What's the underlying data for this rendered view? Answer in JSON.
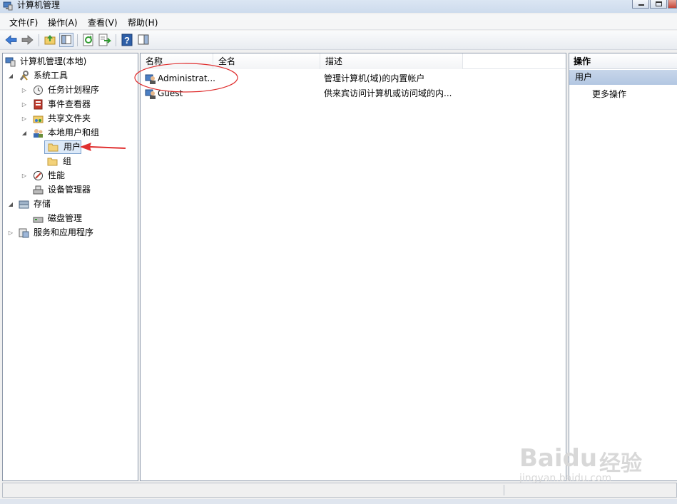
{
  "window": {
    "title": "计算机管理"
  },
  "menu": [
    "文件(F)",
    "操作(A)",
    "查看(V)",
    "帮助(H)"
  ],
  "tree": {
    "root": "计算机管理(本地)",
    "system_tools": "系统工具",
    "task_scheduler": "任务计划程序",
    "event_viewer": "事件查看器",
    "shared_folders": "共享文件夹",
    "local_users_groups": "本地用户和组",
    "users": "用户",
    "groups": "组",
    "performance": "性能",
    "device_manager": "设备管理器",
    "storage": "存储",
    "disk_management": "磁盘管理",
    "services_apps": "服务和应用程序"
  },
  "list": {
    "columns": [
      "名称",
      "全名",
      "描述"
    ],
    "rows": [
      {
        "name": "Administrat...",
        "fullname": "",
        "description": "管理计算机(域)的内置帐户"
      },
      {
        "name": "Guest",
        "fullname": "",
        "description": "供来宾访问计算机或访问域的内..."
      }
    ]
  },
  "actions": {
    "header": "操作",
    "section": "用户",
    "more": "更多操作"
  },
  "watermark": {
    "brand": "Baidu",
    "cn": "经验",
    "url": "jingyan.baidu.com"
  },
  "colors": {
    "accent": "#3a6bb3",
    "annotation": "#e03030",
    "selected": "#dce9f8"
  }
}
